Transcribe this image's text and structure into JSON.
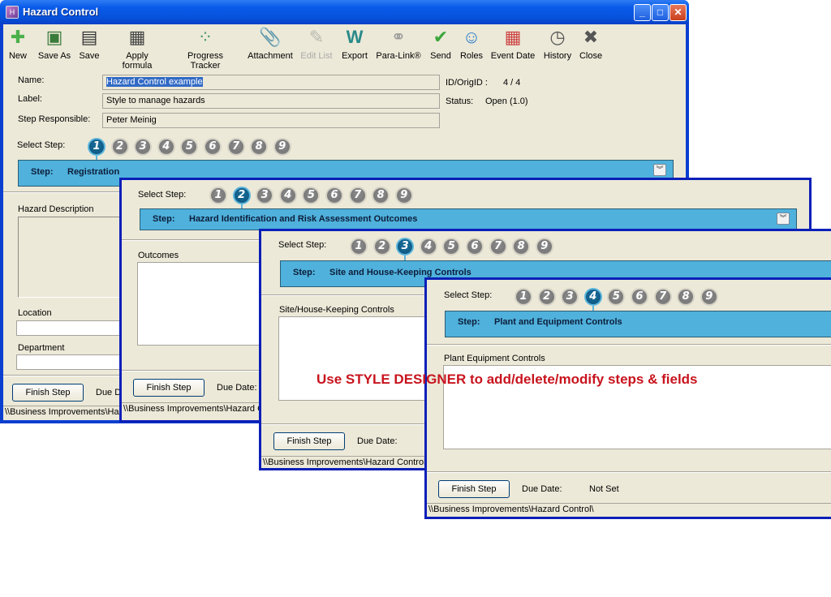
{
  "window": {
    "title": "Hazard Control",
    "controls": {
      "minimize": "_",
      "maximize": "□",
      "close": "✕"
    }
  },
  "toolbar": [
    {
      "label": "New",
      "icon": "new-document-icon",
      "glyph": "📄",
      "enabled": true
    },
    {
      "label": "Save As",
      "icon": "save-as-icon",
      "glyph": "💾",
      "enabled": true
    },
    {
      "label": "Save",
      "icon": "save-icon",
      "glyph": "💾",
      "enabled": true
    },
    {
      "label": "Apply formula",
      "icon": "calculator-icon",
      "glyph": "▦",
      "enabled": true
    },
    {
      "label": "Progress Tracker",
      "icon": "progress-tracker-icon",
      "glyph": "◉",
      "enabled": true
    },
    {
      "label": "Attachment",
      "icon": "paperclip-icon",
      "glyph": "📎",
      "enabled": true
    },
    {
      "label": "Edit List",
      "icon": "edit-list-icon",
      "glyph": "✎",
      "enabled": false
    },
    {
      "label": "Export",
      "icon": "export-word-icon",
      "glyph": "W",
      "enabled": true
    },
    {
      "label": "Para-Link®",
      "icon": "chain-link-icon",
      "glyph": "⛓",
      "enabled": true
    },
    {
      "label": "Send",
      "icon": "send-icon",
      "glyph": "✔",
      "enabled": true
    },
    {
      "label": "Roles",
      "icon": "roles-person-icon",
      "glyph": "👤",
      "enabled": true
    },
    {
      "label": "Event Date",
      "icon": "calendar-icon",
      "glyph": "▦",
      "enabled": true
    },
    {
      "label": "History",
      "icon": "history-clock-icon",
      "glyph": "◷",
      "enabled": true
    },
    {
      "label": "Close",
      "icon": "close-circle-icon",
      "glyph": "✖",
      "enabled": true
    }
  ],
  "form": {
    "name_label": "Name:",
    "name_value": "Hazard Control example",
    "label_label": "Label:",
    "label_value": "Style to manage hazards",
    "responsible_label": "Step Responsible:",
    "responsible_value": "Peter Meinig",
    "id_label": "ID/OrigID :",
    "id_value": "4 / 4",
    "status_label": "Status:",
    "status_value": "Open (1.0)"
  },
  "select_step_label": "Select Step:",
  "step_numbers": [
    "1",
    "2",
    "3",
    "4",
    "5",
    "6",
    "7",
    "8",
    "9"
  ],
  "step_key": "Step:",
  "finish_step": "Finish Step",
  "due_date_label": "Due Date:",
  "status_path": "\\\\Business Improvements\\Hazard Control\\",
  "steps": [
    {
      "active": 1,
      "name": "Registration",
      "fields": [
        "Hazard Description",
        "Location",
        "Department"
      ]
    },
    {
      "active": 2,
      "name": "Hazard Identification and Risk Assessment Outcomes",
      "fields": [
        "Outcomes"
      ]
    },
    {
      "active": 3,
      "name": "Site and House-Keeping Controls",
      "fields": [
        "Site/House-Keeping Controls"
      ]
    },
    {
      "active": 4,
      "name": "Plant and Equipment Controls",
      "fields": [
        "Plant Equipment Controls"
      ],
      "due_date_value": "Not Set"
    }
  ],
  "callout": {
    "prefix": "Use ",
    "emphasis": "STYLE DESIGNER",
    "suffix": " to add/delete/modify steps & fields",
    "color": "#c8141e"
  },
  "colors": {
    "step_bar": "#4fb1dc",
    "active_step": "#0f5b86",
    "window_frame": "#0b1fb8",
    "window_bg": "#ece9d8"
  }
}
